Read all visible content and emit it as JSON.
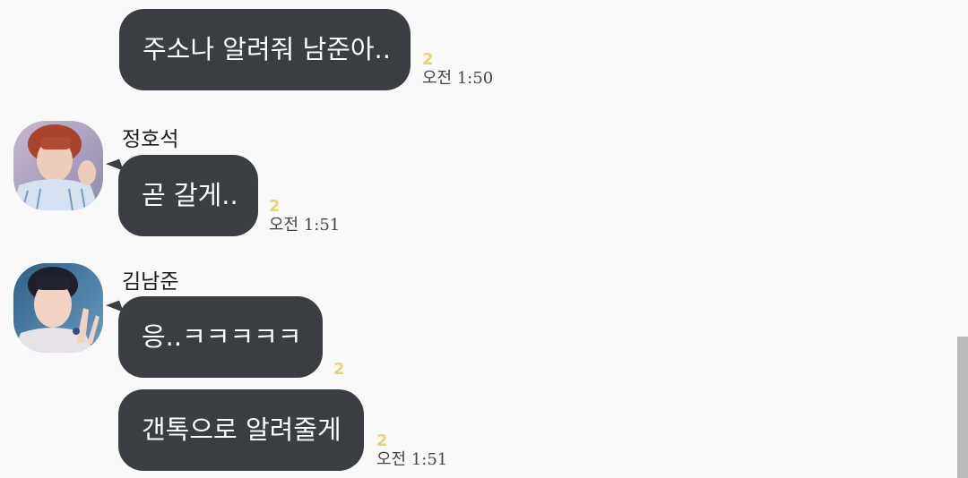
{
  "messages": [
    {
      "sender": "",
      "text": "주소나 알려줘 남준아..",
      "unread": "2",
      "time": "오전 1:50"
    },
    {
      "sender": "정호석",
      "text": "곧 갈게..",
      "unread": "2",
      "time": "오전 1:51"
    },
    {
      "sender": "김남준",
      "text": "응..ㅋㅋㅋㅋㅋ",
      "unread": "2",
      "time": ""
    },
    {
      "sender": "",
      "text": "갠톡으로 알려줄게",
      "unread": "2",
      "time": "오전 1:51"
    }
  ],
  "colors": {
    "background": "#f9f9f9",
    "bubble": "#3a3d42",
    "bubble_text": "#ffffff",
    "unread": "#e8d472"
  }
}
